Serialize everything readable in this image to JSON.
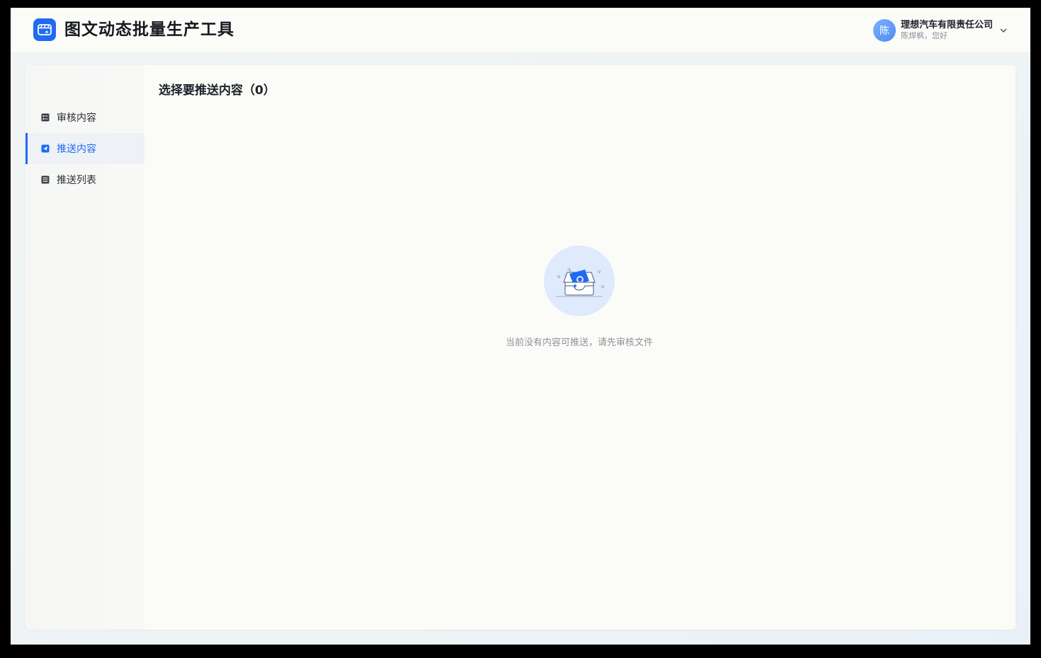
{
  "header": {
    "app_title": "图文动态批量生产工具",
    "logo_icon": "video-edit-icon",
    "accent_color": "#1f6bf3"
  },
  "user": {
    "avatar_text": "陈",
    "company": "理想汽车有限责任公司",
    "greeting": "陈焊枫，您好",
    "dropdown_icon": "chevron-down-icon"
  },
  "sidebar": {
    "items": [
      {
        "label": "审核内容",
        "icon": "review-list-icon",
        "active": false
      },
      {
        "label": "推送内容",
        "icon": "send-icon",
        "active": true
      },
      {
        "label": "推送列表",
        "icon": "list-icon",
        "active": false
      }
    ]
  },
  "main": {
    "title": "选择要推送内容（0）",
    "empty_icon": "empty-inbox-icon",
    "empty_text": "当前没有内容可推送，请先审核文件"
  }
}
